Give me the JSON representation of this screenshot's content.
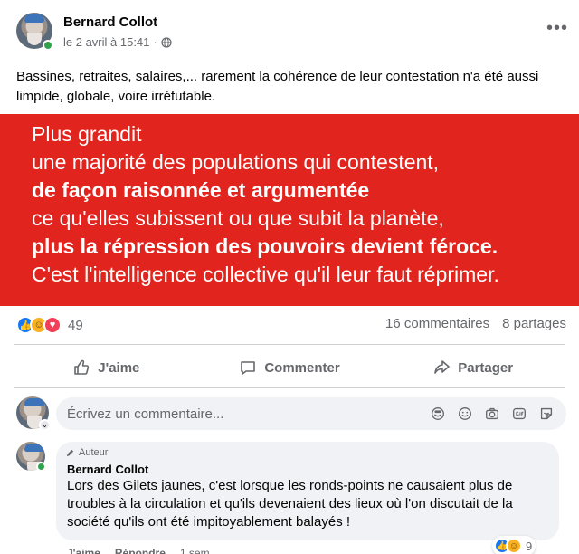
{
  "post": {
    "author": "Bernard Collot",
    "date": "le 2 avril à 15:41",
    "separator": "·",
    "privacy_icon": "globe-icon",
    "more_label": "•••",
    "text": "Bassines, retraites, salaires,... rarement la cohérence de leur contestation n'a été aussi limpide, globale, voire irréfutable."
  },
  "banner": {
    "background": "#e1251e",
    "lines": [
      "Plus grandit",
      "une majorité des populations qui contestent,",
      "de façon raisonnée et argumentée",
      " ce qu'elles subissent ou que subit la planète,",
      "plus la répression des pouvoirs devient féroce.",
      "C'est l'intelligence collective qu'il leur faut réprimer."
    ]
  },
  "stats": {
    "reaction_count": "49",
    "comments": "16 commentaires",
    "shares": "8 partages",
    "reaction_icons": [
      "like-icon",
      "care-icon",
      "love-icon"
    ]
  },
  "actions": {
    "like": "J'aime",
    "comment": "Commenter",
    "share": "Partager"
  },
  "composer": {
    "placeholder": "Écrivez un commentaire...",
    "icons": [
      "avatar-sticker-icon",
      "emoji-icon",
      "camera-icon",
      "gif-icon",
      "sticker-icon"
    ]
  },
  "comment": {
    "badge": "Auteur",
    "author": "Bernard Collot",
    "text": "Lors des Gilets jaunes, c'est lorsque les ronds-points ne causaient plus de troubles à la circulation et qu'ils devenaient des lieux où l'on discutait de la société qu'ils ont été impitoyablement balayés !",
    "reaction_count": "9",
    "like_label": "J'aime",
    "reply_label": "Répondre",
    "time": "1 sem."
  },
  "colors": {
    "accent": "#1877f2",
    "banner_red": "#e1251e",
    "muted_text": "#65676b"
  }
}
